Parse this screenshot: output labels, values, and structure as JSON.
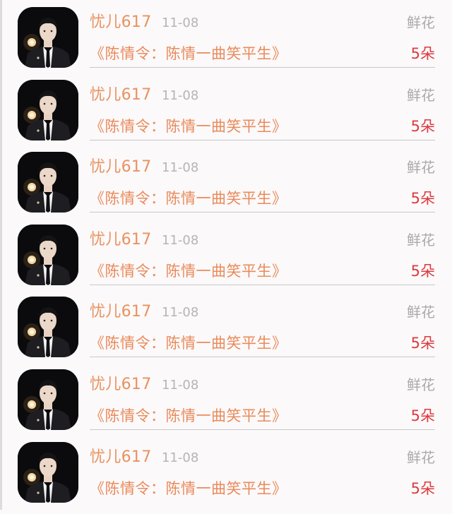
{
  "list": {
    "items": [
      {
        "user": "忧儿617",
        "date": "11-08",
        "gift": "鲜花",
        "title": "《陈情令：陈情一曲笑平生》",
        "count": "5朵"
      },
      {
        "user": "忧儿617",
        "date": "11-08",
        "gift": "鲜花",
        "title": "《陈情令：陈情一曲笑平生》",
        "count": "5朵"
      },
      {
        "user": "忧儿617",
        "date": "11-08",
        "gift": "鲜花",
        "title": "《陈情令：陈情一曲笑平生》",
        "count": "5朵"
      },
      {
        "user": "忧儿617",
        "date": "11-08",
        "gift": "鲜花",
        "title": "《陈情令：陈情一曲笑平生》",
        "count": "5朵"
      },
      {
        "user": "忧儿617",
        "date": "11-08",
        "gift": "鲜花",
        "title": "《陈情令：陈情一曲笑平生》",
        "count": "5朵"
      },
      {
        "user": "忧儿617",
        "date": "11-08",
        "gift": "鲜花",
        "title": "《陈情令：陈情一曲笑平生》",
        "count": "5朵"
      },
      {
        "user": "忧儿617",
        "date": "11-08",
        "gift": "鲜花",
        "title": "《陈情令：陈情一曲笑平生》",
        "count": "5朵"
      }
    ]
  },
  "colors": {
    "username": "#e8925f",
    "title": "#ea8a5a",
    "count": "#dd3a3e",
    "muted": "#aaaaaa"
  }
}
